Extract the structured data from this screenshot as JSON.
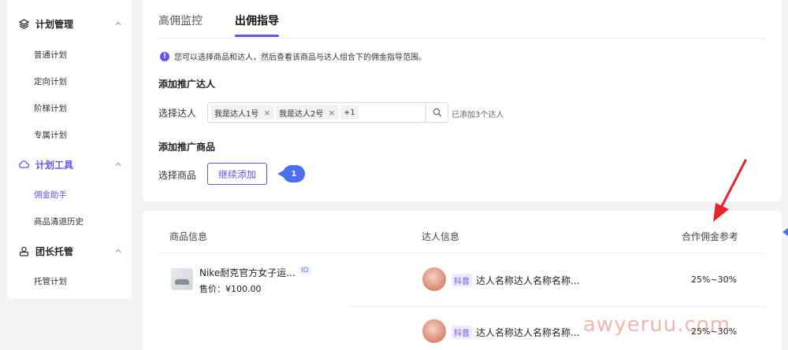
{
  "sidebar": {
    "groups": [
      {
        "title": "计划管理",
        "icon": "layers-icon",
        "items": [
          "普通计划",
          "定向计划",
          "阶梯计划",
          "专属计划"
        ]
      },
      {
        "title": "计划工具",
        "icon": "cloud-icon",
        "items": [
          "佣金助手",
          "商品清退历史"
        ]
      },
      {
        "title": "团长托管",
        "icon": "user-badge-icon",
        "items": [
          "托管计划"
        ]
      }
    ]
  },
  "tabs": [
    "高佣监控",
    "出佣指导"
  ],
  "notice": "您可以选择商品和达人，然后查看该商品与达人组合下的佣金指导范围。",
  "talent_section": {
    "title": "添加推广达人",
    "label": "选择达人",
    "tags": [
      "我是达人1号",
      "我是达人2号"
    ],
    "more": "+1",
    "added_text": "已添加3个达人"
  },
  "product_section": {
    "title": "添加推广商品",
    "label": "选择商品",
    "button": "继续添加",
    "step_badge": "1"
  },
  "table": {
    "headers": [
      "商品信息",
      "达人信息",
      "合作佣金参考"
    ],
    "product": {
      "name": "Nike耐克官方女子运...",
      "id_badge": "ID",
      "price": "售价：¥100.00"
    },
    "rows": [
      {
        "platform": "抖音",
        "name": "达人名称达人名称名称...",
        "rate": "25%~30%"
      },
      {
        "platform": "抖音",
        "name": "达人名称达人名称名称...",
        "rate": "25%~30%"
      }
    ]
  },
  "watermark": "awyeruu.com",
  "colors": {
    "accent": "#6a4ff0",
    "badge_blue": "#4c6ef0",
    "arrow": "#e8232a"
  }
}
